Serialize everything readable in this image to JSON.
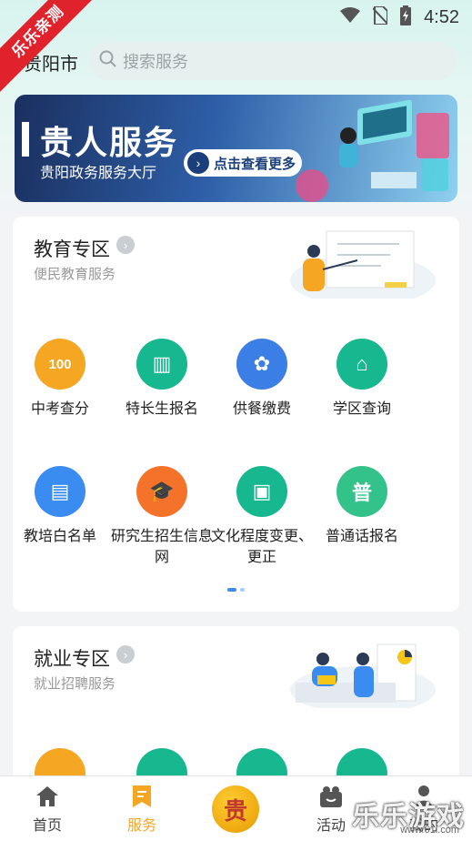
{
  "status_bar": {
    "time": "4:52"
  },
  "ribbon": {
    "text": "乐乐亲测"
  },
  "header": {
    "city": "贵阳市",
    "search_placeholder": "搜索服务"
  },
  "banner": {
    "title": "贵人服务",
    "subtitle": "贵阳政务服务大厅",
    "button_label": "点击查看更多"
  },
  "education": {
    "title": "教育专区",
    "subtitle": "便民教育服务",
    "items": [
      {
        "label": "中考查分",
        "icon": "score-search-icon",
        "color": "#f5a623",
        "glyph": "100"
      },
      {
        "label": "特长生报名",
        "icon": "building-icon",
        "color": "#17b890",
        "glyph": "▥"
      },
      {
        "label": "供餐缴费",
        "icon": "meal-icon",
        "color": "#3b7fe6",
        "glyph": "✿"
      },
      {
        "label": "学区查询",
        "icon": "school-district-icon",
        "color": "#17b890",
        "glyph": "⌂"
      },
      {
        "label": "教培白名单",
        "icon": "whitelist-icon",
        "color": "#3b8cf0",
        "glyph": "▤"
      },
      {
        "label": "研究生招生信息网",
        "icon": "graduate-cap-icon",
        "color": "#f5722b",
        "glyph": "🎓"
      },
      {
        "label": "文化程度变更、更正",
        "icon": "education-record-icon",
        "color": "#17b890",
        "glyph": "▣"
      },
      {
        "label": "普通话报名",
        "icon": "mandarin-register-icon",
        "color": "#33c38a",
        "glyph": "普"
      }
    ]
  },
  "employment": {
    "title": "就业专区",
    "subtitle": "就业招聘服务",
    "items": [
      {
        "icon": "job-icon-1",
        "color": "#f5a623"
      },
      {
        "icon": "job-icon-2",
        "color": "#17b890"
      },
      {
        "icon": "job-icon-3",
        "color": "#17b890"
      },
      {
        "icon": "job-icon-4",
        "color": "#17b890"
      }
    ]
  },
  "tabbar": {
    "items": [
      {
        "label": "首页",
        "icon": "home-icon"
      },
      {
        "label": "服务",
        "icon": "service-icon",
        "active": true
      },
      {
        "label": "活动",
        "icon": "activity-icon"
      },
      {
        "label": "我的",
        "icon": "user-icon"
      }
    ],
    "active_color": "#f5a623",
    "inactive_color": "#444444"
  },
  "watermark": {
    "text": "乐乐游戏",
    "url": "www.61l.com"
  }
}
